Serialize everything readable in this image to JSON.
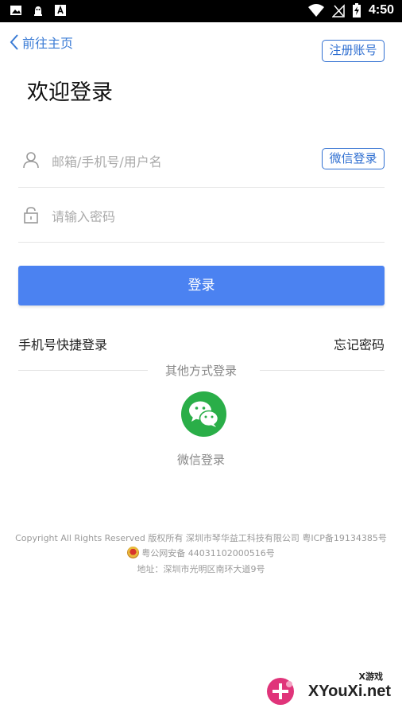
{
  "statusbar": {
    "time": "4:50"
  },
  "nav": {
    "back_label": "前往主页",
    "register_label": "注册账号"
  },
  "page": {
    "title": "欢迎登录"
  },
  "form": {
    "username_placeholder": "邮箱/手机号/用户名",
    "username_value": "",
    "password_placeholder": "请输入密码",
    "password_value": "",
    "wechat_login_small": "微信登录",
    "login_button": "登录"
  },
  "links": {
    "phone_login": "手机号快捷登录",
    "forgot_password": "忘记密码"
  },
  "other": {
    "divider_text": "其他方式登录",
    "wechat_label": "微信登录"
  },
  "footer": {
    "line1": "Copyright All Rights Reserved 版权所有 深圳市琴华益工科技有限公司 粤ICP备19134385号",
    "line2": "粤公网安备 44031102000516号",
    "line3": "地址：深圳市光明区南环大道9号"
  },
  "watermark": {
    "small": "X游戏",
    "main": "XYouXi.net"
  },
  "colors": {
    "accent": "#4b82f1",
    "link_blue": "#2f6fd1",
    "wechat_green": "#2aae48"
  }
}
